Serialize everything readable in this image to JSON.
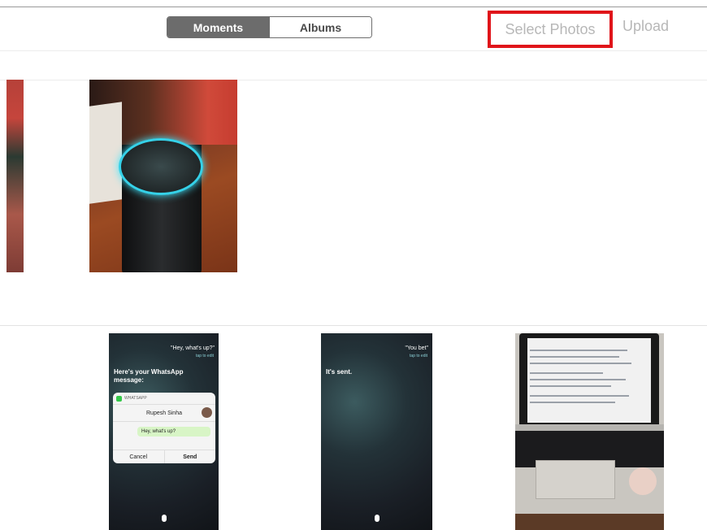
{
  "toolbar": {
    "segmented": {
      "moments": "Moments",
      "albums": "Albums",
      "selected": "Moments"
    },
    "select_photos": "Select Photos",
    "upload": "Upload"
  },
  "highlight_color": "#e0151a",
  "photos": {
    "siri_whatsapp": {
      "query": "\"Hey, what's up?\"",
      "tap_to_edit": "tap to edit",
      "message_intro": "Here's your WhatsApp message:",
      "app": "WHATSAPP",
      "recipient": "Rupesh Sinha",
      "bubble": "Hey, what's up?",
      "cancel": "Cancel",
      "send": "Send"
    },
    "siri_sent": {
      "query": "\"You bet\"",
      "tap_to_edit": "tap to edit",
      "message": "It's sent."
    }
  }
}
